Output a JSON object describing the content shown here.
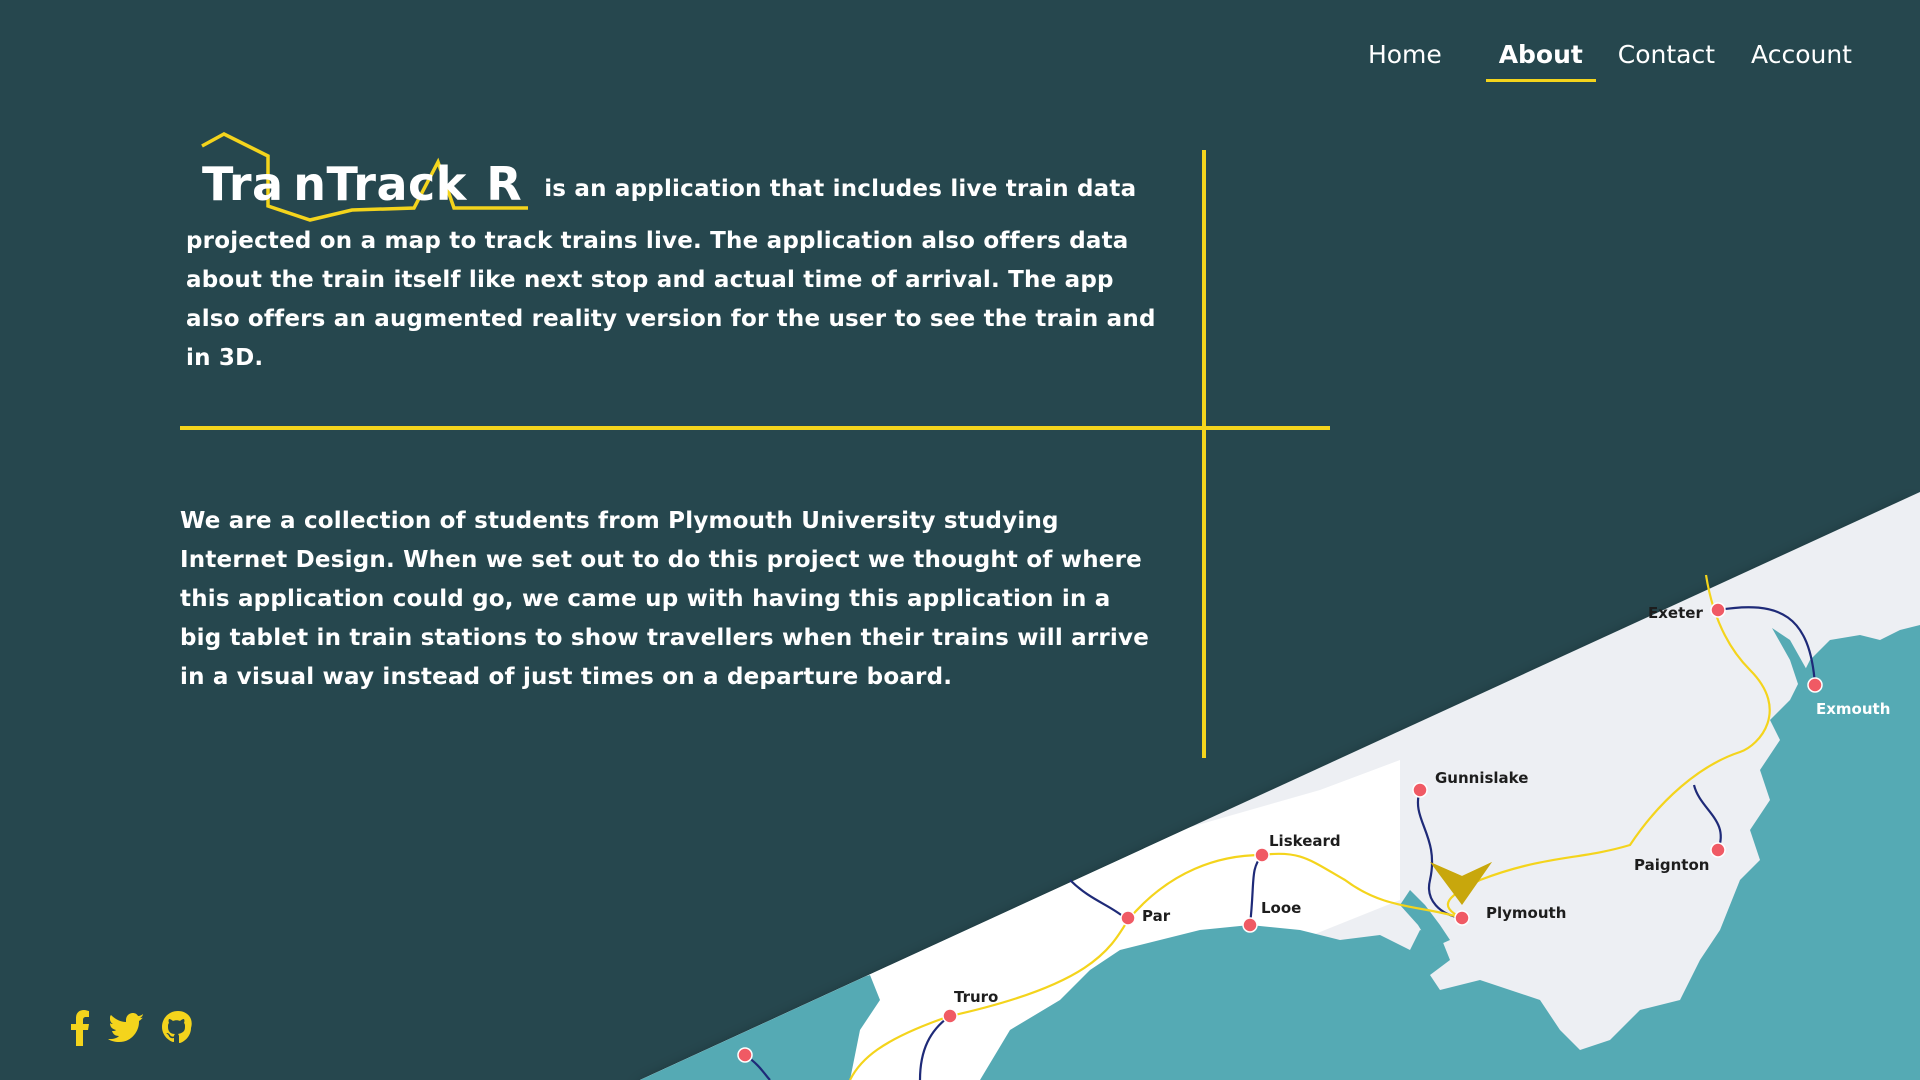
{
  "nav": {
    "home": "Home",
    "about": "About",
    "contact": "Contact",
    "account": "Account",
    "active": "About"
  },
  "logo": {
    "text": "TrainTrackAR",
    "display": "Tra nTrack  R"
  },
  "intro": {
    "text": "is an application that includes live train data projected on a map to track trains live. The application also offers data about the train itself like next stop and actual time of arrival.  The app also offers an augmented reality version for the user to see the train and in 3D."
  },
  "about": {
    "text": "We are a collection of students from Plymouth University studying Internet Design. When we set out to do this project we thought of where this application could go, we came up with having this application in a big tablet in train stations to show travellers when their trains will arrive in a visual way instead of just times on a departure board."
  },
  "map": {
    "stations": [
      "Exeter",
      "Exmouth",
      "Gunnislake",
      "Liskeard",
      "Par",
      "Looe",
      "Plymouth",
      "Paignton",
      "Truro"
    ]
  },
  "social": {
    "icons": [
      "facebook-icon",
      "twitter-icon",
      "github-icon"
    ]
  },
  "colors": {
    "background": "#26474e",
    "accent": "#f4d41c",
    "land": "#edeff3",
    "sea": "#55aab4",
    "station": "#f05a64",
    "branch_line": "#1e2a78"
  }
}
